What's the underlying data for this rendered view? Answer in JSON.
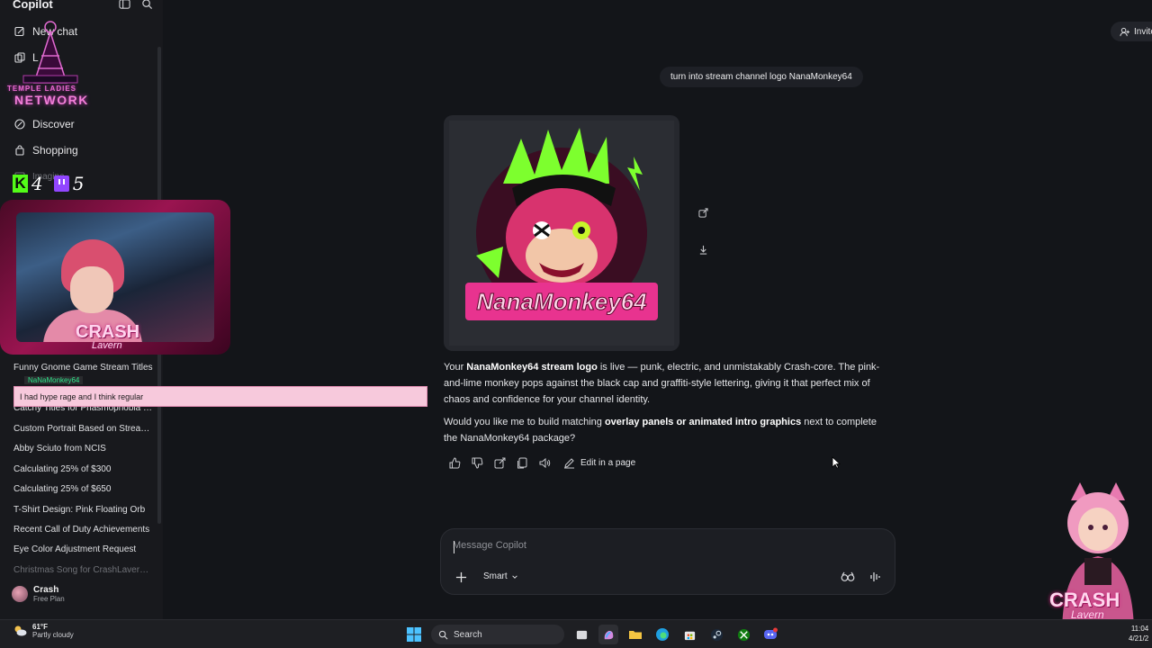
{
  "sidebar": {
    "app_title": "Copilot",
    "items": [
      {
        "label": "New chat",
        "icon": "new-chat-icon"
      },
      {
        "label": "L",
        "icon": "library-icon"
      },
      {
        "label": "Discover",
        "icon": "discover-icon"
      },
      {
        "label": "Shopping",
        "icon": "shopping-icon"
      },
      {
        "label": "Imagine",
        "icon": "imagine-icon"
      }
    ],
    "history": [
      "Funny Gnome Game Stream Titles",
      "Catchy Titles for Phasmophobia S...",
      "Custom Portrait Based on Stream...",
      "Abby Sciuto from NCIS",
      "Calculating 25% of $300",
      "Calculating 25% of $650",
      "T-Shirt Design: Pink Floating Orb",
      "Recent Call of Duty Achievements",
      "Eye Color Adjustment Request",
      "Christmas Song for CrashLavern ..."
    ],
    "profile": {
      "name": "Crash",
      "plan": "Free Plan"
    }
  },
  "overlay": {
    "network_line1": "TEMPLE LADIES",
    "network_line2": "NETWORK",
    "kick_letter": "K",
    "kick_count": "4",
    "twitch_count": "5",
    "webcam_name": "CRASH",
    "webcam_sub": "Lavern",
    "chat_user": "NaNaMonkey64",
    "chat_message": "I had hype rage and I think regular",
    "corner_name": "CRASH",
    "corner_sub": "Lavern"
  },
  "header": {
    "invite_label": "Invite"
  },
  "conversation": {
    "user_message": "turn into stream channel logo NanaMonkey64",
    "image_text": "NanaMonkey64",
    "response": {
      "p1_a": "Your ",
      "p1_b": "NanaMonkey64 stream logo",
      "p1_c": " is live — punk, electric, and unmistakably Crash-core. The pink-and-lime monkey pops against the black cap and graffiti-style lettering, giving it that perfect mix of chaos and confidence for your channel identity.",
      "p2_a": "Would you like me to build matching ",
      "p2_b": "overlay panels or animated intro graphics",
      "p2_c": " next to complete the NanaMonkey64 package?"
    },
    "edit_label": "Edit in a page"
  },
  "composer": {
    "placeholder": "Message Copilot",
    "mode": "Smart"
  },
  "taskbar": {
    "temperature": "61°F",
    "weather": "Partly cloudy",
    "search_label": "Search",
    "time": "11:04",
    "date": "4/21/2"
  },
  "colors": {
    "background": "#131519",
    "sidebar": "#18191d",
    "accent_pink": "#e8338f",
    "accent_lime": "#7dff2e"
  }
}
